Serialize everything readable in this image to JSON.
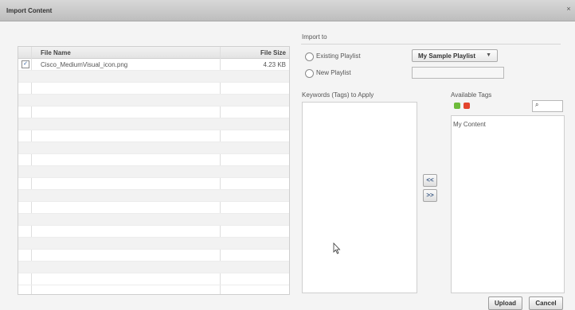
{
  "window": {
    "title": "Import Content",
    "close_glyph": "×"
  },
  "file_table": {
    "columns": [
      "File Name",
      "File Size"
    ],
    "rows": [
      {
        "checked": true,
        "name": "Cisco_MediumVisual_icon.png",
        "size": "4.23 KB"
      }
    ]
  },
  "import_to": {
    "label": "Import to",
    "existing_label": "Existing Playlist",
    "new_label": "New Playlist",
    "selected_playlist": "My Sample Playlist",
    "new_playlist_value": ""
  },
  "tags": {
    "apply_label": "Keywords (Tags) to Apply",
    "available_label": "Available Tags",
    "available_items": [
      "My Content"
    ],
    "add_glyph": "<<",
    "remove_glyph": ">>"
  },
  "footer": {
    "upload_label": "Upload",
    "cancel_label": "Cancel"
  },
  "icons": [
    "close-icon",
    "checkbox-icon",
    "dropdown-arrow-icon",
    "add-tag-icon",
    "delete-tag-icon",
    "search-icon",
    "mouse-cursor-icon"
  ]
}
